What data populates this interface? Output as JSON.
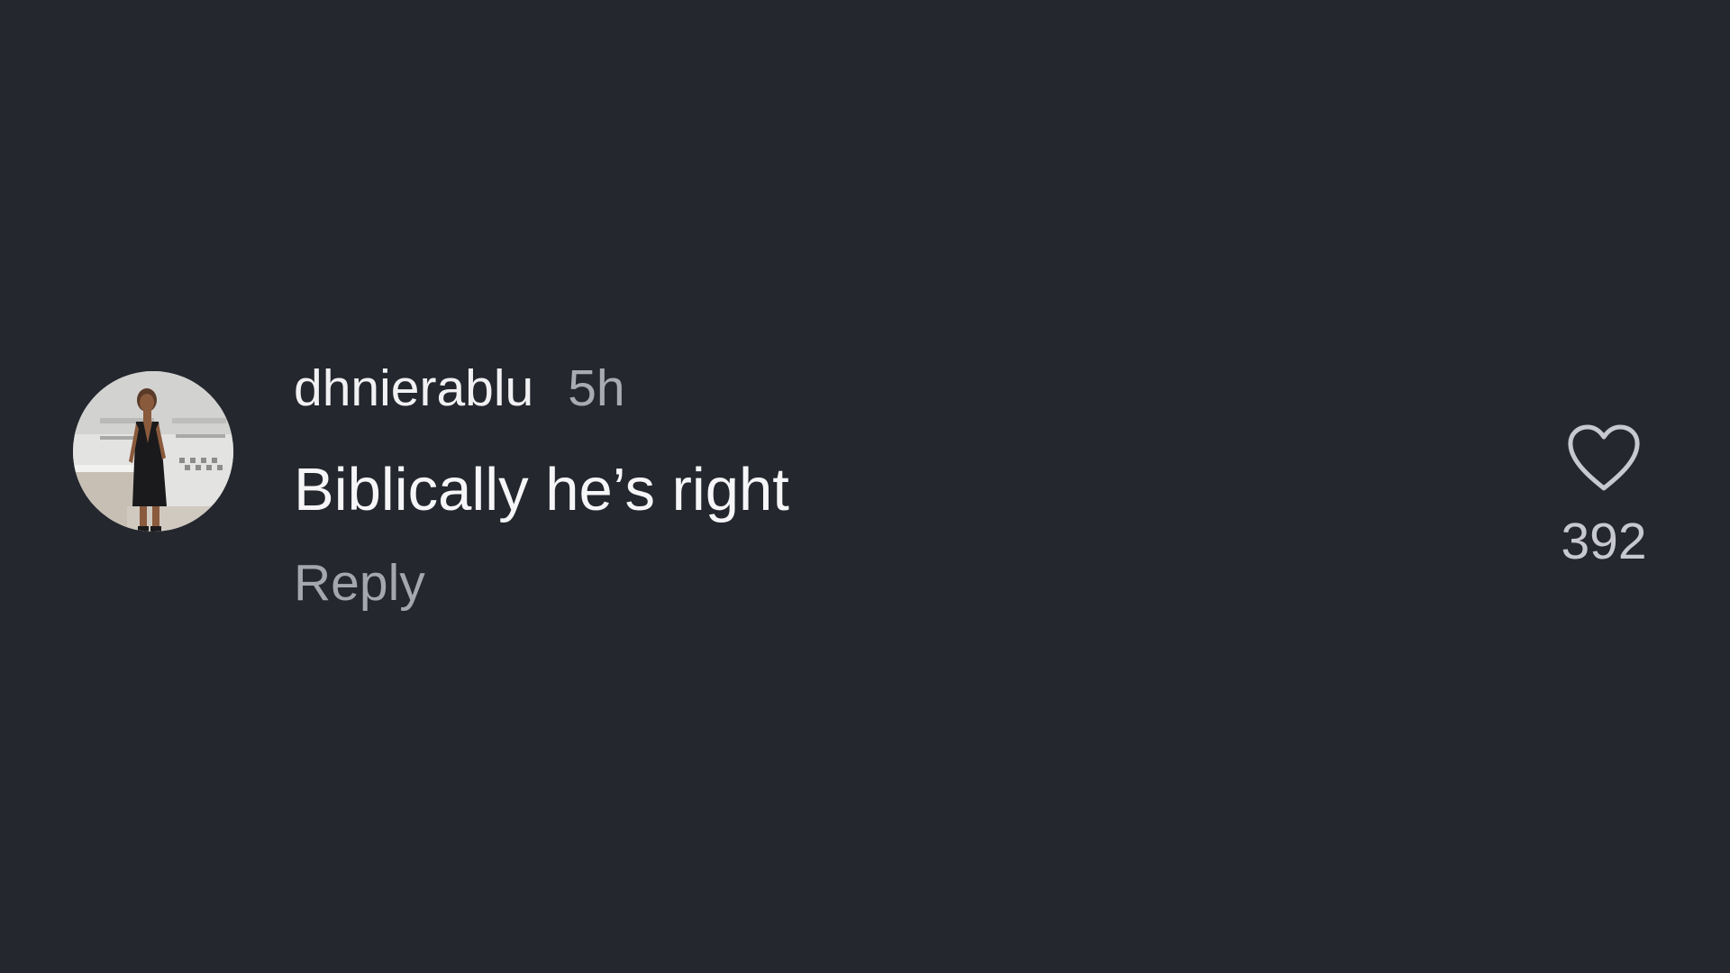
{
  "comment": {
    "username": "dhnierablu",
    "timestamp": "5h",
    "text": "Biblically he’s right",
    "reply_label": "Reply",
    "like_count": "392",
    "avatar": "profile-photo"
  },
  "icons": {
    "like": "heart-outline-icon"
  },
  "colors": {
    "background": "#24272e",
    "username": "#f1f1f3",
    "timestamp": "#a9abb2",
    "text": "#f6f6f8",
    "reply": "#a5a7ae",
    "like_count": "#c8c9ce"
  }
}
